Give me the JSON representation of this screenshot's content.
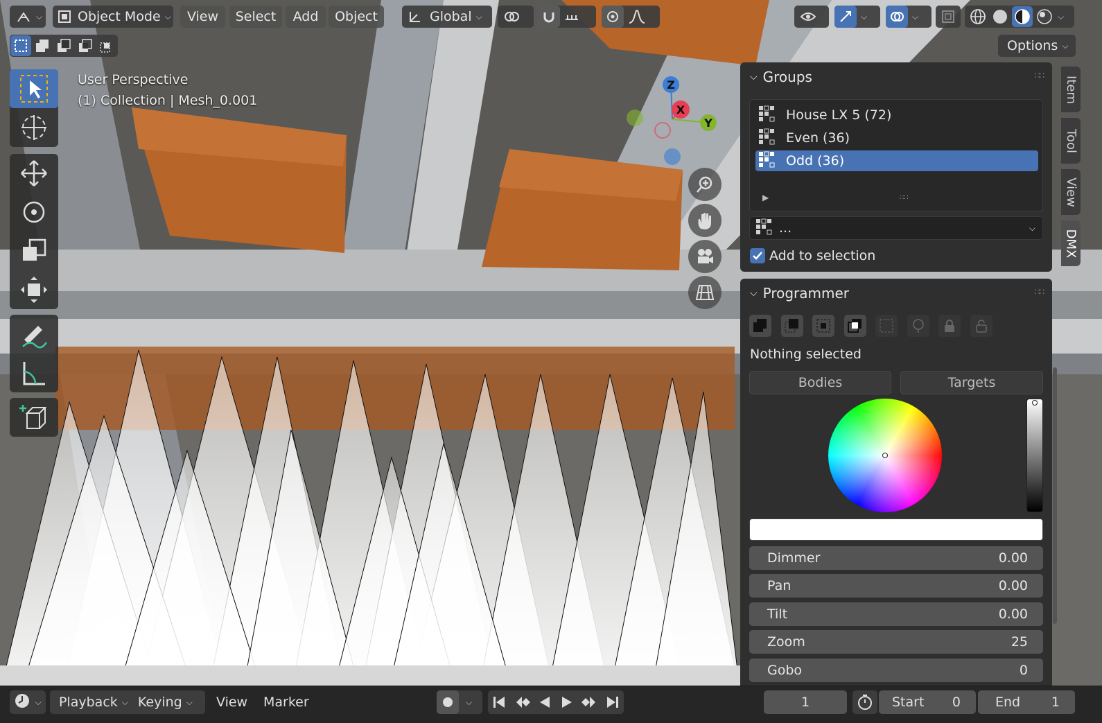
{
  "header": {
    "mode": "Object Mode",
    "menus": [
      "View",
      "Select",
      "Add",
      "Object"
    ],
    "transform_orientation": "Global",
    "options_label": "Options"
  },
  "viewport": {
    "perspective": "User Perspective",
    "collection_info": "(1) Collection | Mesh_0.001",
    "gizmo_labels": {
      "z": "Z",
      "x": "X",
      "y": "Y"
    }
  },
  "sidebar_tabs": [
    "Item",
    "Tool",
    "View",
    "DMX"
  ],
  "groups_panel": {
    "title": "Groups",
    "items": [
      {
        "label": "House LX 5 (72)",
        "selected": false
      },
      {
        "label": "Even (36)",
        "selected": false
      },
      {
        "label": "Odd (36)",
        "selected": true
      }
    ],
    "dropdown_value": "...",
    "add_to_selection_label": "Add to selection",
    "add_to_selection_checked": true
  },
  "programmer_panel": {
    "title": "Programmer",
    "status": "Nothing selected",
    "tabs": [
      "Bodies",
      "Targets"
    ],
    "fields": [
      {
        "label": "Dimmer",
        "value": "0.00"
      },
      {
        "label": "Pan",
        "value": "0.00"
      },
      {
        "label": "Tilt",
        "value": "0.00"
      },
      {
        "label": "Zoom",
        "value": "25"
      },
      {
        "label": "Gobo",
        "value": "0"
      }
    ]
  },
  "timeline": {
    "playback_label": "Playback",
    "keying_label": "Keying",
    "view_label": "View",
    "marker_label": "Marker",
    "current_frame": "1",
    "start_label": "Start",
    "start_value": "0",
    "end_label": "End",
    "end_value": "1"
  },
  "colors": {
    "accent": "#4772b3",
    "axis_x": "#e83d53",
    "axis_y": "#84b52e",
    "axis_z": "#3c7dd6",
    "wood": "#b8652a"
  }
}
